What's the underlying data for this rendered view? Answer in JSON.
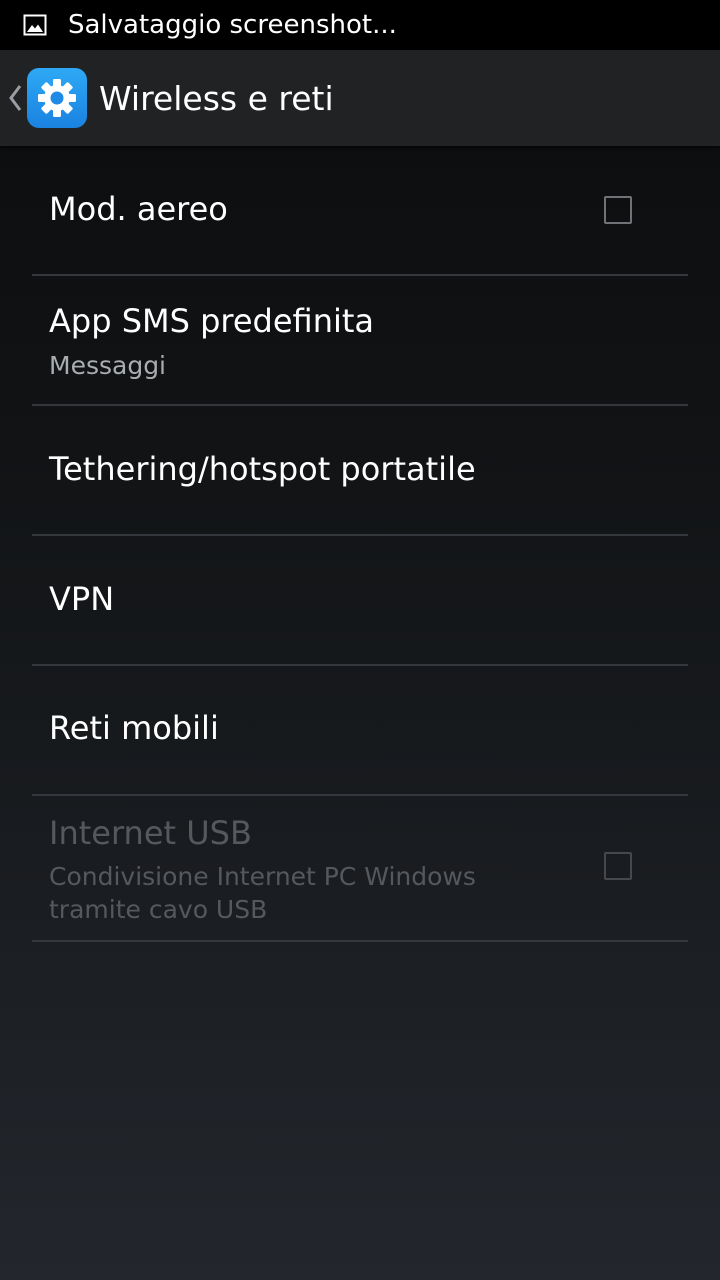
{
  "status_bar": {
    "notification_icon": "image-icon",
    "text": "Salvataggio screenshot..."
  },
  "action_bar": {
    "back_icon": "chevron-left-icon",
    "app_icon": "settings-gear-icon",
    "title": "Wireless e reti"
  },
  "items": [
    {
      "title": "Mod. aereo",
      "checkbox": true,
      "checked": false,
      "enabled": true
    },
    {
      "title": "App SMS predefinita",
      "summary": "Messaggi",
      "enabled": true
    },
    {
      "title": "Tethering/hotspot portatile",
      "enabled": true
    },
    {
      "title": "VPN",
      "enabled": true
    },
    {
      "title": "Reti mobili",
      "enabled": true
    },
    {
      "title": "Internet USB",
      "summary": "Condivisione Internet PC Windows tramite cavo USB",
      "checkbox": true,
      "checked": false,
      "enabled": false
    }
  ],
  "colors": {
    "accent": "#1a82e0",
    "divider": "#34373b",
    "summary_text": "#a9acb0",
    "disabled_text": "#55585c"
  }
}
